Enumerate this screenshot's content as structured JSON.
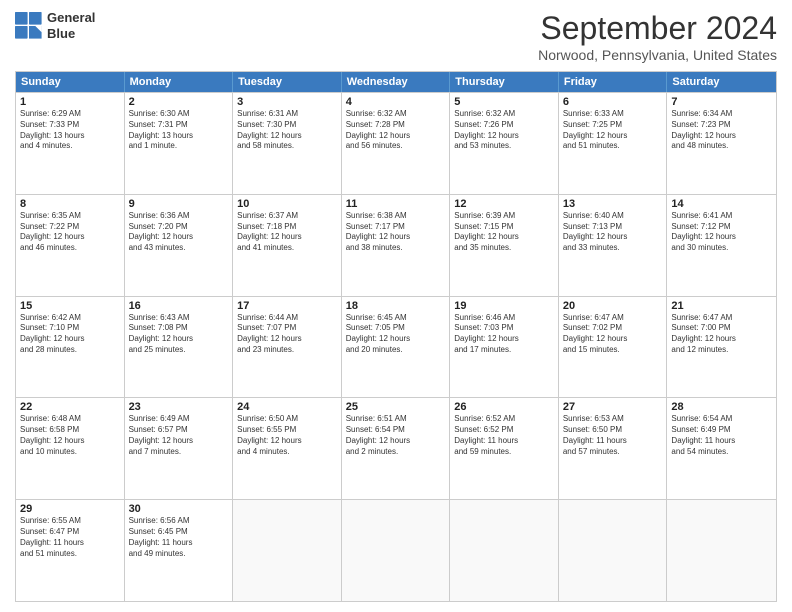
{
  "logo": {
    "line1": "General",
    "line2": "Blue"
  },
  "title": "September 2024",
  "location": "Norwood, Pennsylvania, United States",
  "days": [
    "Sunday",
    "Monday",
    "Tuesday",
    "Wednesday",
    "Thursday",
    "Friday",
    "Saturday"
  ],
  "rows": [
    [
      {
        "day": "1",
        "lines": [
          "Sunrise: 6:29 AM",
          "Sunset: 7:33 PM",
          "Daylight: 13 hours",
          "and 4 minutes."
        ]
      },
      {
        "day": "2",
        "lines": [
          "Sunrise: 6:30 AM",
          "Sunset: 7:31 PM",
          "Daylight: 13 hours",
          "and 1 minute."
        ]
      },
      {
        "day": "3",
        "lines": [
          "Sunrise: 6:31 AM",
          "Sunset: 7:30 PM",
          "Daylight: 12 hours",
          "and 58 minutes."
        ]
      },
      {
        "day": "4",
        "lines": [
          "Sunrise: 6:32 AM",
          "Sunset: 7:28 PM",
          "Daylight: 12 hours",
          "and 56 minutes."
        ]
      },
      {
        "day": "5",
        "lines": [
          "Sunrise: 6:32 AM",
          "Sunset: 7:26 PM",
          "Daylight: 12 hours",
          "and 53 minutes."
        ]
      },
      {
        "day": "6",
        "lines": [
          "Sunrise: 6:33 AM",
          "Sunset: 7:25 PM",
          "Daylight: 12 hours",
          "and 51 minutes."
        ]
      },
      {
        "day": "7",
        "lines": [
          "Sunrise: 6:34 AM",
          "Sunset: 7:23 PM",
          "Daylight: 12 hours",
          "and 48 minutes."
        ]
      }
    ],
    [
      {
        "day": "8",
        "lines": [
          "Sunrise: 6:35 AM",
          "Sunset: 7:22 PM",
          "Daylight: 12 hours",
          "and 46 minutes."
        ]
      },
      {
        "day": "9",
        "lines": [
          "Sunrise: 6:36 AM",
          "Sunset: 7:20 PM",
          "Daylight: 12 hours",
          "and 43 minutes."
        ]
      },
      {
        "day": "10",
        "lines": [
          "Sunrise: 6:37 AM",
          "Sunset: 7:18 PM",
          "Daylight: 12 hours",
          "and 41 minutes."
        ]
      },
      {
        "day": "11",
        "lines": [
          "Sunrise: 6:38 AM",
          "Sunset: 7:17 PM",
          "Daylight: 12 hours",
          "and 38 minutes."
        ]
      },
      {
        "day": "12",
        "lines": [
          "Sunrise: 6:39 AM",
          "Sunset: 7:15 PM",
          "Daylight: 12 hours",
          "and 35 minutes."
        ]
      },
      {
        "day": "13",
        "lines": [
          "Sunrise: 6:40 AM",
          "Sunset: 7:13 PM",
          "Daylight: 12 hours",
          "and 33 minutes."
        ]
      },
      {
        "day": "14",
        "lines": [
          "Sunrise: 6:41 AM",
          "Sunset: 7:12 PM",
          "Daylight: 12 hours",
          "and 30 minutes."
        ]
      }
    ],
    [
      {
        "day": "15",
        "lines": [
          "Sunrise: 6:42 AM",
          "Sunset: 7:10 PM",
          "Daylight: 12 hours",
          "and 28 minutes."
        ]
      },
      {
        "day": "16",
        "lines": [
          "Sunrise: 6:43 AM",
          "Sunset: 7:08 PM",
          "Daylight: 12 hours",
          "and 25 minutes."
        ]
      },
      {
        "day": "17",
        "lines": [
          "Sunrise: 6:44 AM",
          "Sunset: 7:07 PM",
          "Daylight: 12 hours",
          "and 23 minutes."
        ]
      },
      {
        "day": "18",
        "lines": [
          "Sunrise: 6:45 AM",
          "Sunset: 7:05 PM",
          "Daylight: 12 hours",
          "and 20 minutes."
        ]
      },
      {
        "day": "19",
        "lines": [
          "Sunrise: 6:46 AM",
          "Sunset: 7:03 PM",
          "Daylight: 12 hours",
          "and 17 minutes."
        ]
      },
      {
        "day": "20",
        "lines": [
          "Sunrise: 6:47 AM",
          "Sunset: 7:02 PM",
          "Daylight: 12 hours",
          "and 15 minutes."
        ]
      },
      {
        "day": "21",
        "lines": [
          "Sunrise: 6:47 AM",
          "Sunset: 7:00 PM",
          "Daylight: 12 hours",
          "and 12 minutes."
        ]
      }
    ],
    [
      {
        "day": "22",
        "lines": [
          "Sunrise: 6:48 AM",
          "Sunset: 6:58 PM",
          "Daylight: 12 hours",
          "and 10 minutes."
        ]
      },
      {
        "day": "23",
        "lines": [
          "Sunrise: 6:49 AM",
          "Sunset: 6:57 PM",
          "Daylight: 12 hours",
          "and 7 minutes."
        ]
      },
      {
        "day": "24",
        "lines": [
          "Sunrise: 6:50 AM",
          "Sunset: 6:55 PM",
          "Daylight: 12 hours",
          "and 4 minutes."
        ]
      },
      {
        "day": "25",
        "lines": [
          "Sunrise: 6:51 AM",
          "Sunset: 6:54 PM",
          "Daylight: 12 hours",
          "and 2 minutes."
        ]
      },
      {
        "day": "26",
        "lines": [
          "Sunrise: 6:52 AM",
          "Sunset: 6:52 PM",
          "Daylight: 11 hours",
          "and 59 minutes."
        ]
      },
      {
        "day": "27",
        "lines": [
          "Sunrise: 6:53 AM",
          "Sunset: 6:50 PM",
          "Daylight: 11 hours",
          "and 57 minutes."
        ]
      },
      {
        "day": "28",
        "lines": [
          "Sunrise: 6:54 AM",
          "Sunset: 6:49 PM",
          "Daylight: 11 hours",
          "and 54 minutes."
        ]
      }
    ],
    [
      {
        "day": "29",
        "lines": [
          "Sunrise: 6:55 AM",
          "Sunset: 6:47 PM",
          "Daylight: 11 hours",
          "and 51 minutes."
        ]
      },
      {
        "day": "30",
        "lines": [
          "Sunrise: 6:56 AM",
          "Sunset: 6:45 PM",
          "Daylight: 11 hours",
          "and 49 minutes."
        ]
      },
      {
        "day": "",
        "lines": []
      },
      {
        "day": "",
        "lines": []
      },
      {
        "day": "",
        "lines": []
      },
      {
        "day": "",
        "lines": []
      },
      {
        "day": "",
        "lines": []
      }
    ]
  ]
}
